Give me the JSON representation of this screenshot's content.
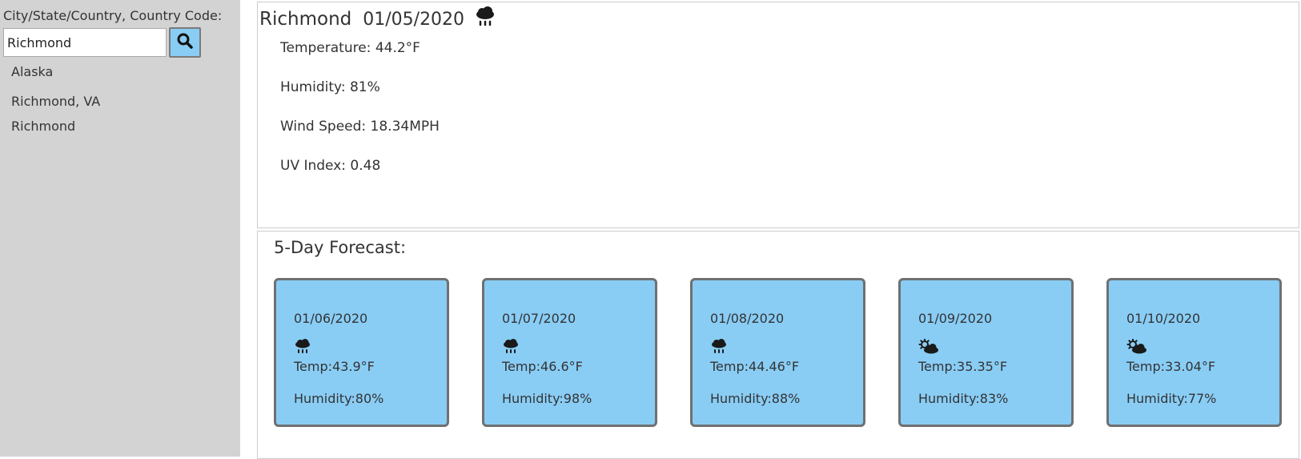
{
  "sidebar": {
    "search_label": "City/State/Country, Country Code:",
    "search_value": "Richmond",
    "search_icon": "search-icon",
    "history": [
      "Alaska",
      "Richmond, VA",
      "Richmond"
    ]
  },
  "current": {
    "city": "Richmond",
    "date": "01/05/2020",
    "icon": "rain-cloud-icon",
    "temperature": "Temperature: 44.2°F",
    "humidity": "Humidity: 81%",
    "wind_speed": "Wind Speed: 18.34MPH",
    "uv_index": "UV Index: 0.48"
  },
  "forecast": {
    "title": "5-Day Forecast:",
    "days": [
      {
        "date": "01/06/2020",
        "icon": "rain-cloud-icon",
        "temp": "Temp:43.9°F",
        "humidity": "Humidity:80%"
      },
      {
        "date": "01/07/2020",
        "icon": "rain-cloud-icon",
        "temp": "Temp:46.6°F",
        "humidity": "Humidity:98%"
      },
      {
        "date": "01/08/2020",
        "icon": "rain-cloud-icon",
        "temp": "Temp:44.46°F",
        "humidity": "Humidity:88%"
      },
      {
        "date": "01/09/2020",
        "icon": "partly-cloudy-icon",
        "temp": "Temp:35.35°F",
        "humidity": "Humidity:83%"
      },
      {
        "date": "01/10/2020",
        "icon": "partly-cloudy-icon",
        "temp": "Temp:33.04°F",
        "humidity": "Humidity:77%"
      }
    ]
  },
  "colors": {
    "sidebar_bg": "#d3d3d3",
    "card_bg": "#89cdf5",
    "card_border": "#707070"
  }
}
